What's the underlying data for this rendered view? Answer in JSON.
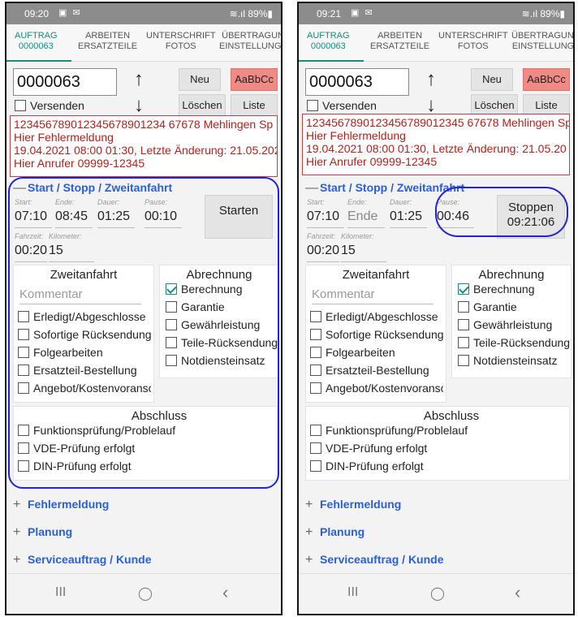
{
  "screens": [
    {
      "status": {
        "time": "09:20",
        "icons": "▣ ✉",
        "right": "≋.ıl 89%▮"
      },
      "tabs": [
        {
          "label": "AUFTRAG",
          "sub": "0000063"
        },
        {
          "label": "ARBEITEN",
          "sub": "ERSATZTEILE"
        },
        {
          "label": "UNTERSCHRIFT",
          "sub": "FOTOS"
        },
        {
          "label": "ÜBERTRAGUNG",
          "sub": "EINSTELLUNGEN"
        }
      ],
      "order_number": "0000063",
      "buttons": {
        "new": "Neu",
        "style": "AaBbCc",
        "delete": "Löschen",
        "list": "Liste"
      },
      "send_label": "Versenden",
      "info_lines": [
        "12345678901234567890123​4 67678 Mehlingen Sp",
        "Hier Fehlermeldung",
        "19.04.2021 08:00 01:30, Letzte Änderung: 21.05.202",
        "Hier Anrufer 09999-12345"
      ],
      "section_title": "Start / Stopp / Zweitanfahrt",
      "times": {
        "start_label": "Start:",
        "start": "07:10",
        "end_label": "Ende:",
        "end": "08:45",
        "duration_label": "Dauer:",
        "duration": "01:25",
        "pause_label": "Pause:",
        "pause": "00:10",
        "drive_label": "Fahrzeit:",
        "drive": "00:20",
        "km_label": "Kilometer:",
        "km": "15"
      },
      "action_button": {
        "label": "Starten",
        "sub": ""
      },
      "second_trip": {
        "title": "Zweitanfahrt",
        "comment_placeholder": "Kommentar",
        "items": [
          {
            "label": "Erledigt/Abgeschlosse",
            "checked": false
          },
          {
            "label": "Sofortige Rücksendung",
            "checked": false
          },
          {
            "label": "Folgearbeiten",
            "checked": false
          },
          {
            "label": "Ersatzteil-Bestellung",
            "checked": false
          },
          {
            "label": "Angebot/Kostenvoranschl",
            "checked": false
          }
        ]
      },
      "billing": {
        "title": "Abrechnung",
        "items": [
          {
            "label": "Berechnung",
            "checked": true
          },
          {
            "label": "Garantie",
            "checked": false
          },
          {
            "label": "Gewährleistung",
            "checked": false
          },
          {
            "label": "Teile-Rücksendung",
            "checked": false
          },
          {
            "label": "Notdiensteinsatz",
            "checked": false
          }
        ]
      },
      "closing": {
        "title": "Abschluss",
        "items": [
          {
            "label": "Funktionsprüfung/Problelauf",
            "checked": false
          },
          {
            "label": "VDE-Prüfung erfolgt",
            "checked": false
          },
          {
            "label": "DIN-Prüfung erfolgt",
            "checked": false
          }
        ]
      },
      "collapsed_sections": [
        "Fehlermeldung",
        "Planung",
        "Serviceauftrag / Kunde"
      ],
      "navbar": {
        "recent": "III",
        "home": "◯",
        "back": "‹"
      }
    },
    {
      "status": {
        "time": "09:21",
        "icons": "▣ ✉",
        "right": "≋.ıl 89%▮"
      },
      "tabs": [
        {
          "label": "AUFTRAG",
          "sub": "0000063"
        },
        {
          "label": "ARBEITEN",
          "sub": "ERSATZTEILE"
        },
        {
          "label": "UNTERSCHRIFT",
          "sub": "FOTOS"
        },
        {
          "label": "ÜBERTRAGUNG",
          "sub": "EINSTELLUNGE"
        }
      ],
      "order_number": "0000063",
      "buttons": {
        "new": "Neu",
        "style": "AaBbCc",
        "delete": "Löschen",
        "list": "Liste"
      },
      "send_label": "Versenden",
      "info_lines": [
        "1234567890123456789012345 67678 Mehlingen Sp",
        "Hier Fehlermeldung",
        "19.04.2021 08:00 01:30, Letzte Änderung: 21.05.20",
        "Hier Anrufer 09999-12345"
      ],
      "section_title": "Start / Stopp / Zweitanfahrt",
      "times": {
        "start_label": "Start:",
        "start": "07:10",
        "end_label": "Ende:",
        "end": "Ende",
        "duration_label": "Dauer:",
        "duration": "01:25",
        "pause_label": "Pause:",
        "pause": "00:46",
        "drive_label": "Fahrzeit:",
        "drive": "00:20",
        "km_label": "Kilometer:",
        "km": "15"
      },
      "action_button": {
        "label": "Stoppen",
        "sub": "09:21:06"
      },
      "second_trip": {
        "title": "Zweitanfahrt",
        "comment_placeholder": "Kommentar",
        "items": [
          {
            "label": "Erledigt/Abgeschlosse",
            "checked": false
          },
          {
            "label": "Sofortige Rücksendung",
            "checked": false
          },
          {
            "label": "Folgearbeiten",
            "checked": false
          },
          {
            "label": "Ersatzteil-Bestellung",
            "checked": false
          },
          {
            "label": "Angebot/Kostenvoranschl",
            "checked": false
          }
        ]
      },
      "billing": {
        "title": "Abrechnung",
        "items": [
          {
            "label": "Berechnung",
            "checked": true
          },
          {
            "label": "Garantie",
            "checked": false
          },
          {
            "label": "Gewährleistung",
            "checked": false
          },
          {
            "label": "Teile-Rücksendung",
            "checked": false
          },
          {
            "label": "Notdiensteinsatz",
            "checked": false
          }
        ]
      },
      "closing": {
        "title": "Abschluss",
        "items": [
          {
            "label": "Funktionsprüfung/Problelauf",
            "checked": false
          },
          {
            "label": "VDE-Prüfung erfolgt",
            "checked": false
          },
          {
            "label": "DIN-Prüfung erfolgt",
            "checked": false
          }
        ]
      },
      "collapsed_sections": [
        "Fehlermeldung",
        "Planung",
        "Serviceauftrag / Kunde"
      ],
      "navbar": {
        "recent": "III",
        "home": "◯",
        "back": "‹"
      }
    }
  ]
}
